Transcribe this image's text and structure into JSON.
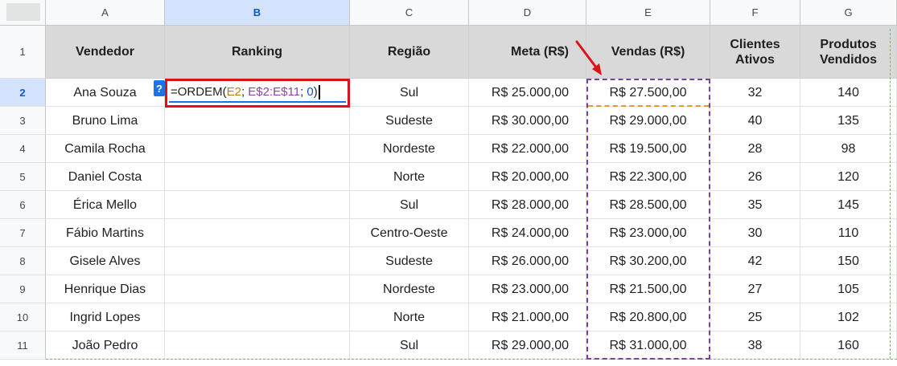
{
  "columns": [
    "A",
    "B",
    "C",
    "D",
    "E",
    "F",
    "G"
  ],
  "row_numbers": [
    "1",
    "2",
    "3",
    "4",
    "5",
    "6",
    "7",
    "8",
    "9",
    "10",
    "11"
  ],
  "headers": {
    "vendedor": "Vendedor",
    "ranking": "Ranking",
    "regiao": "Região",
    "meta": "Meta (R$)",
    "vendas": "Vendas (R$)",
    "clientes_1": "Clientes",
    "clientes_2": "Ativos",
    "produtos_1": "Produtos",
    "produtos_2": "Vendidos"
  },
  "rows": [
    {
      "vendedor": "Ana Souza",
      "regiao": "Sul",
      "meta": "R$ 25.000,00",
      "vendas": "R$ 27.500,00",
      "clientes": "32",
      "produtos": "140"
    },
    {
      "vendedor": "Bruno Lima",
      "regiao": "Sudeste",
      "meta": "R$ 30.000,00",
      "vendas": "R$ 29.000,00",
      "clientes": "40",
      "produtos": "135"
    },
    {
      "vendedor": "Camila Rocha",
      "regiao": "Nordeste",
      "meta": "R$ 22.000,00",
      "vendas": "R$ 19.500,00",
      "clientes": "28",
      "produtos": "98"
    },
    {
      "vendedor": "Daniel Costa",
      "regiao": "Norte",
      "meta": "R$ 20.000,00",
      "vendas": "R$ 22.300,00",
      "clientes": "26",
      "produtos": "120"
    },
    {
      "vendedor": "Érica Mello",
      "regiao": "Sul",
      "meta": "R$ 28.000,00",
      "vendas": "R$ 28.500,00",
      "clientes": "35",
      "produtos": "145"
    },
    {
      "vendedor": "Fábio Martins",
      "regiao": "Centro-Oeste",
      "meta": "R$ 24.000,00",
      "vendas": "R$ 23.000,00",
      "clientes": "30",
      "produtos": "110"
    },
    {
      "vendedor": "Gisele Alves",
      "regiao": "Sudeste",
      "meta": "R$ 26.000,00",
      "vendas": "R$ 30.200,00",
      "clientes": "42",
      "produtos": "150"
    },
    {
      "vendedor": "Henrique Dias",
      "regiao": "Nordeste",
      "meta": "R$ 23.000,00",
      "vendas": "R$ 21.500,00",
      "clientes": "27",
      "produtos": "105"
    },
    {
      "vendedor": "Ingrid Lopes",
      "regiao": "Norte",
      "meta": "R$ 21.000,00",
      "vendas": "R$ 20.800,00",
      "clientes": "25",
      "produtos": "102"
    },
    {
      "vendedor": "João Pedro",
      "regiao": "Sul",
      "meta": "R$ 29.000,00",
      "vendas": "R$ 31.000,00",
      "clientes": "38",
      "produtos": "160"
    }
  ],
  "formula": {
    "func": "=ORDEM(",
    "ref1": "E2",
    "sep1": "; ",
    "ref2": "E$2:E$11",
    "sep2": "; ",
    "num": "0",
    "close": ")"
  },
  "help_label": "?",
  "colors": {
    "header_fill": "#d9d9d9",
    "selected_header": "#d3e3fd",
    "edit_border": "#e0101a",
    "range_border": "#7b3fa0",
    "ref_highlight": "#e8972c",
    "arrow": "#e0101a"
  },
  "icons": {
    "arrow": "red-arrow-icon",
    "help": "help-icon"
  }
}
